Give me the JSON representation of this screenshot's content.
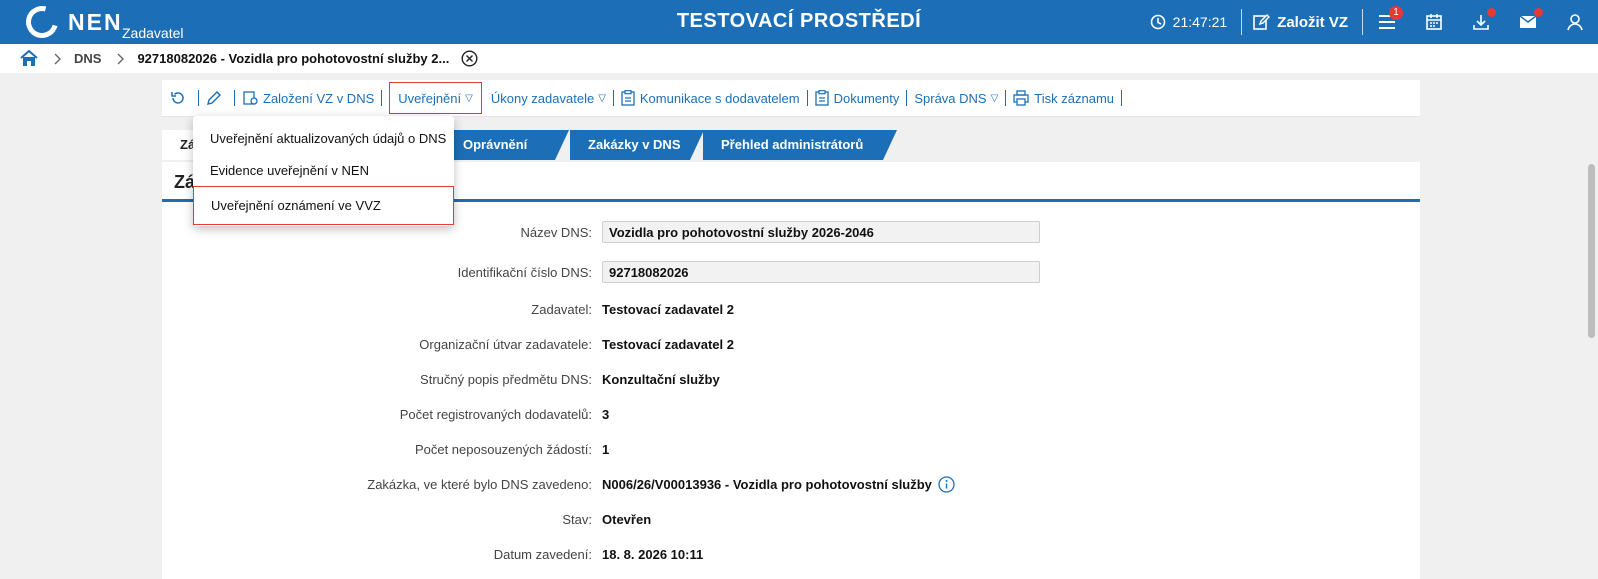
{
  "header": {
    "logo_text": "NEN",
    "logo_sub": "Zadavatel",
    "env_title": "TESTOVACÍ PROSTŘEDÍ",
    "time": "21:47:21",
    "create_label": "Založit VZ",
    "menu_badge": "1"
  },
  "breadcrumb": {
    "dns": "DNS",
    "current": "92718082026 - Vozidla pro pohotovostní služby 2..."
  },
  "toolbar": {
    "zalozeni": "Založení VZ v DNS",
    "uverejneni": "Uveřejnění",
    "ukony": "Úkony zadavatele",
    "komunikace": "Komunikace s dodavatelem",
    "dokumenty": "Dokumenty",
    "sprava": "Správa DNS",
    "tisk": "Tisk záznamu",
    "drop_glyph": "▽"
  },
  "tabs": {
    "first": "Zá",
    "opravneni": "Oprávnění",
    "zakazky": "Zakázky v DNS",
    "admins": "Přehled administrátorů"
  },
  "panel": {
    "heading": "Zá"
  },
  "dropdown": {
    "items": [
      "Uveřejnění aktualizovaných údajů o DNS",
      "Evidence uveřejnění v NEN",
      "Uveřejnění oznámení ve VVZ"
    ]
  },
  "fields": {
    "nazev": {
      "label": "Název DNS:",
      "value": "Vozidla pro pohotovostní služby 2026-2046"
    },
    "ident": {
      "label": "Identifikační číslo DNS:",
      "value": "92718082026"
    },
    "zadavatel": {
      "label": "Zadavatel:",
      "value": "Testovací zadavatel 2"
    },
    "utvar": {
      "label": "Organizační útvar zadavatele:",
      "value": "Testovací zadavatel 2"
    },
    "popis": {
      "label": "Stručný popis předmětu DNS:",
      "value": "Konzultační služby"
    },
    "pocet_dod": {
      "label": "Počet registrovaných dodavatelů:",
      "value": "3"
    },
    "pocet_zad": {
      "label": "Počet neposouzených žádostí:",
      "value": "1"
    },
    "zakazka": {
      "label": "Zakázka, ve které bylo DNS zavedeno:",
      "value": "N006/26/V00013936 - Vozidla pro pohotovostní služby"
    },
    "stav": {
      "label": "Stav:",
      "value": "Otevřen"
    },
    "datum": {
      "label": "Datum zavedení:",
      "value": "18. 8. 2026 10:11"
    }
  },
  "colors": {
    "brand": "#1c6fb6",
    "highlight": "#e53935"
  }
}
